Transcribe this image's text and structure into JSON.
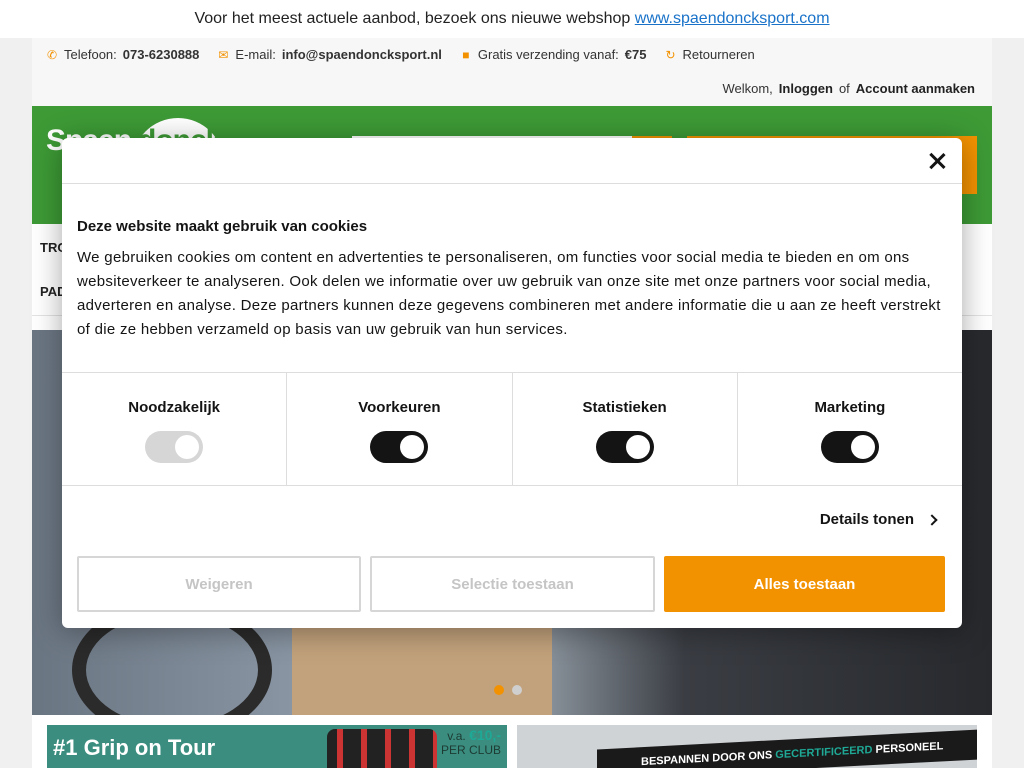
{
  "banner": {
    "text": "Voor het meest actuele aanbod, bezoek ons nieuwe webshop",
    "link": "www.spaendoncksport.com"
  },
  "info_bar": {
    "phone_label": "Telefoon:",
    "phone": "073-6230888",
    "email_label": "E-mail:",
    "email": "info@spaendoncksport.nl",
    "shipping_label": "Gratis verzending vanaf:",
    "shipping_value": "€75",
    "returns": "Retourneren",
    "welcome": "Welkom,",
    "login": "Inloggen",
    "or": "of",
    "create_account": "Account aanmaken"
  },
  "logo": {
    "part1": "Spaen",
    "part2": "donck"
  },
  "nav": {
    "item1": "TRO",
    "item2": "PAD"
  },
  "promo": {
    "left_title": "#1 Grip on Tour",
    "left_price_prefix": "v.a.",
    "left_price": "€10,-",
    "left_price_suffix": "PER CLUB",
    "right_text_a": "BESPANNEN DOOR ONS",
    "right_text_b": "GECERTIFICEERD",
    "right_text_c": "PERSONEEL"
  },
  "carousel": {
    "slides": 2,
    "active": 1
  },
  "cookie": {
    "title": "Deze website maakt gebruik van cookies",
    "text": "We gebruiken cookies om content en advertenties te personaliseren, om functies voor social media te bieden en om ons websiteverkeer te analyseren. Ook delen we informatie over uw gebruik van onze site met onze partners voor social media, adverteren en analyse. Deze partners kunnen deze gegevens combineren met andere informatie die u aan ze heeft verstrekt of die ze hebben verzameld op basis van uw gebruik van hun services.",
    "toggles": [
      {
        "label": "Noodzakelijk",
        "on": true,
        "disabled": true
      },
      {
        "label": "Voorkeuren",
        "on": true,
        "disabled": false
      },
      {
        "label": "Statistieken",
        "on": true,
        "disabled": false
      },
      {
        "label": "Marketing",
        "on": true,
        "disabled": false
      }
    ],
    "details": "Details tonen",
    "btn_refuse": "Weigeren",
    "btn_selection": "Selectie toestaan",
    "btn_allow_all": "Alles toestaan"
  },
  "colors": {
    "brand_green": "#3d9a35",
    "accent_orange": "#f39200",
    "toggle_on": "#141414",
    "toggle_disabled": "#d6d6d6"
  }
}
